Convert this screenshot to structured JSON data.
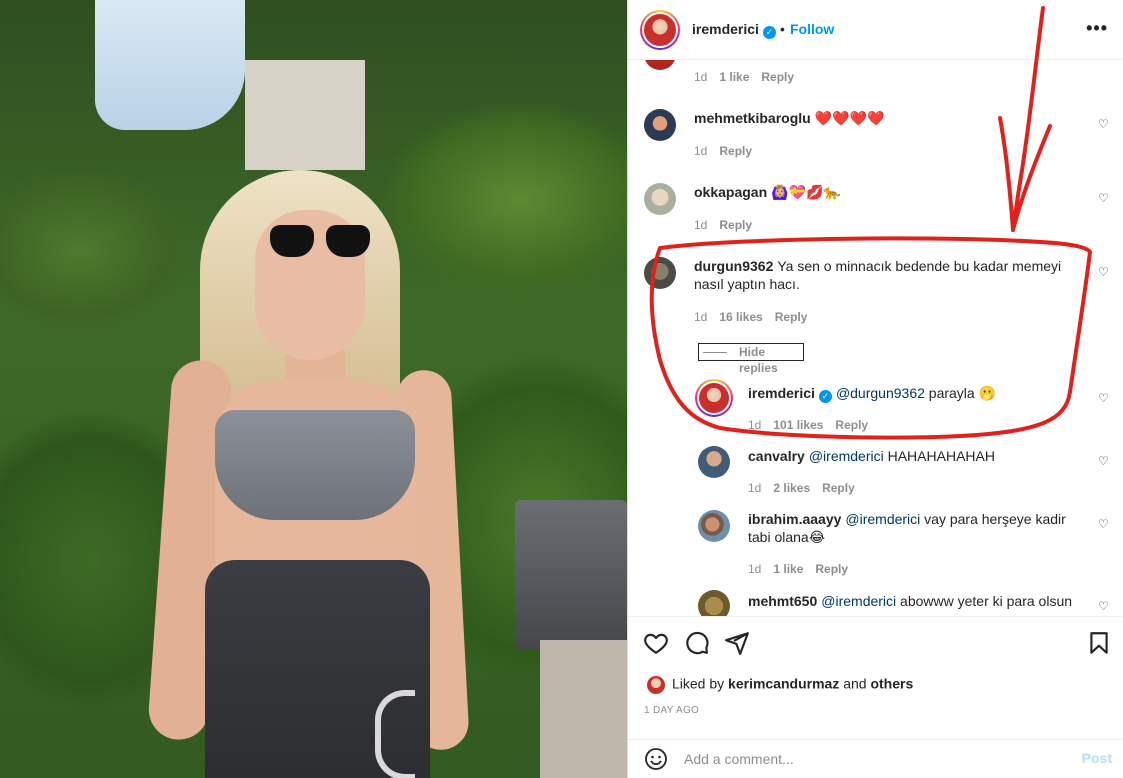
{
  "post": {
    "username": "iremderici",
    "verified_mark": "✓",
    "dot": "•",
    "follow_label": "Follow",
    "more": "•••"
  },
  "comments": [
    {
      "id": "c0",
      "time": "1d",
      "likes": "1 like",
      "reply": "Reply"
    },
    {
      "id": "c1",
      "user": "mehmetkibaroglu",
      "text": "❤️❤️❤️❤️",
      "time": "1d",
      "reply": "Reply"
    },
    {
      "id": "c2",
      "user": "okkapagan",
      "text": "🙆🏼‍♀️💝💋🐆",
      "time": "1d",
      "reply": "Reply"
    },
    {
      "id": "c3",
      "user": "durgun9362",
      "text": "Ya sen o minnacık bedende bu kadar memeyi nasıl yaptın hacı.",
      "time": "1d",
      "likes": "16 likes",
      "reply": "Reply",
      "hide_replies": "Hide replies"
    },
    {
      "id": "r1",
      "user": "iremderici",
      "mention": "@durgun9362",
      "text": "parayla 🫢",
      "time": "1d",
      "likes": "101 likes",
      "reply": "Reply"
    },
    {
      "id": "r2",
      "user": "canvalry",
      "mention": "@iremderici",
      "text": "HAHAHAHAHAH",
      "time": "1d",
      "likes": "2 likes",
      "reply": "Reply"
    },
    {
      "id": "r3",
      "user": "ibrahim.aaayy",
      "mention": "@iremderici",
      "text": "vay para herşeye kadir tabi olana😂",
      "time": "1d",
      "likes": "1 like",
      "reply": "Reply"
    },
    {
      "id": "r4",
      "user": "mehmt650",
      "mention": "@iremderici",
      "text": "abowww yeter ki para olsun"
    }
  ],
  "footer": {
    "liked_prefix": "Liked by",
    "liked_user": "kerimcandurmaz",
    "liked_and": "and",
    "liked_others": "others",
    "time_ago": "1 DAY AGO",
    "comment_placeholder": "Add a comment...",
    "post_label": "Post"
  },
  "colors": {
    "accent": "#0095f6",
    "annotation": "#e0221c"
  }
}
